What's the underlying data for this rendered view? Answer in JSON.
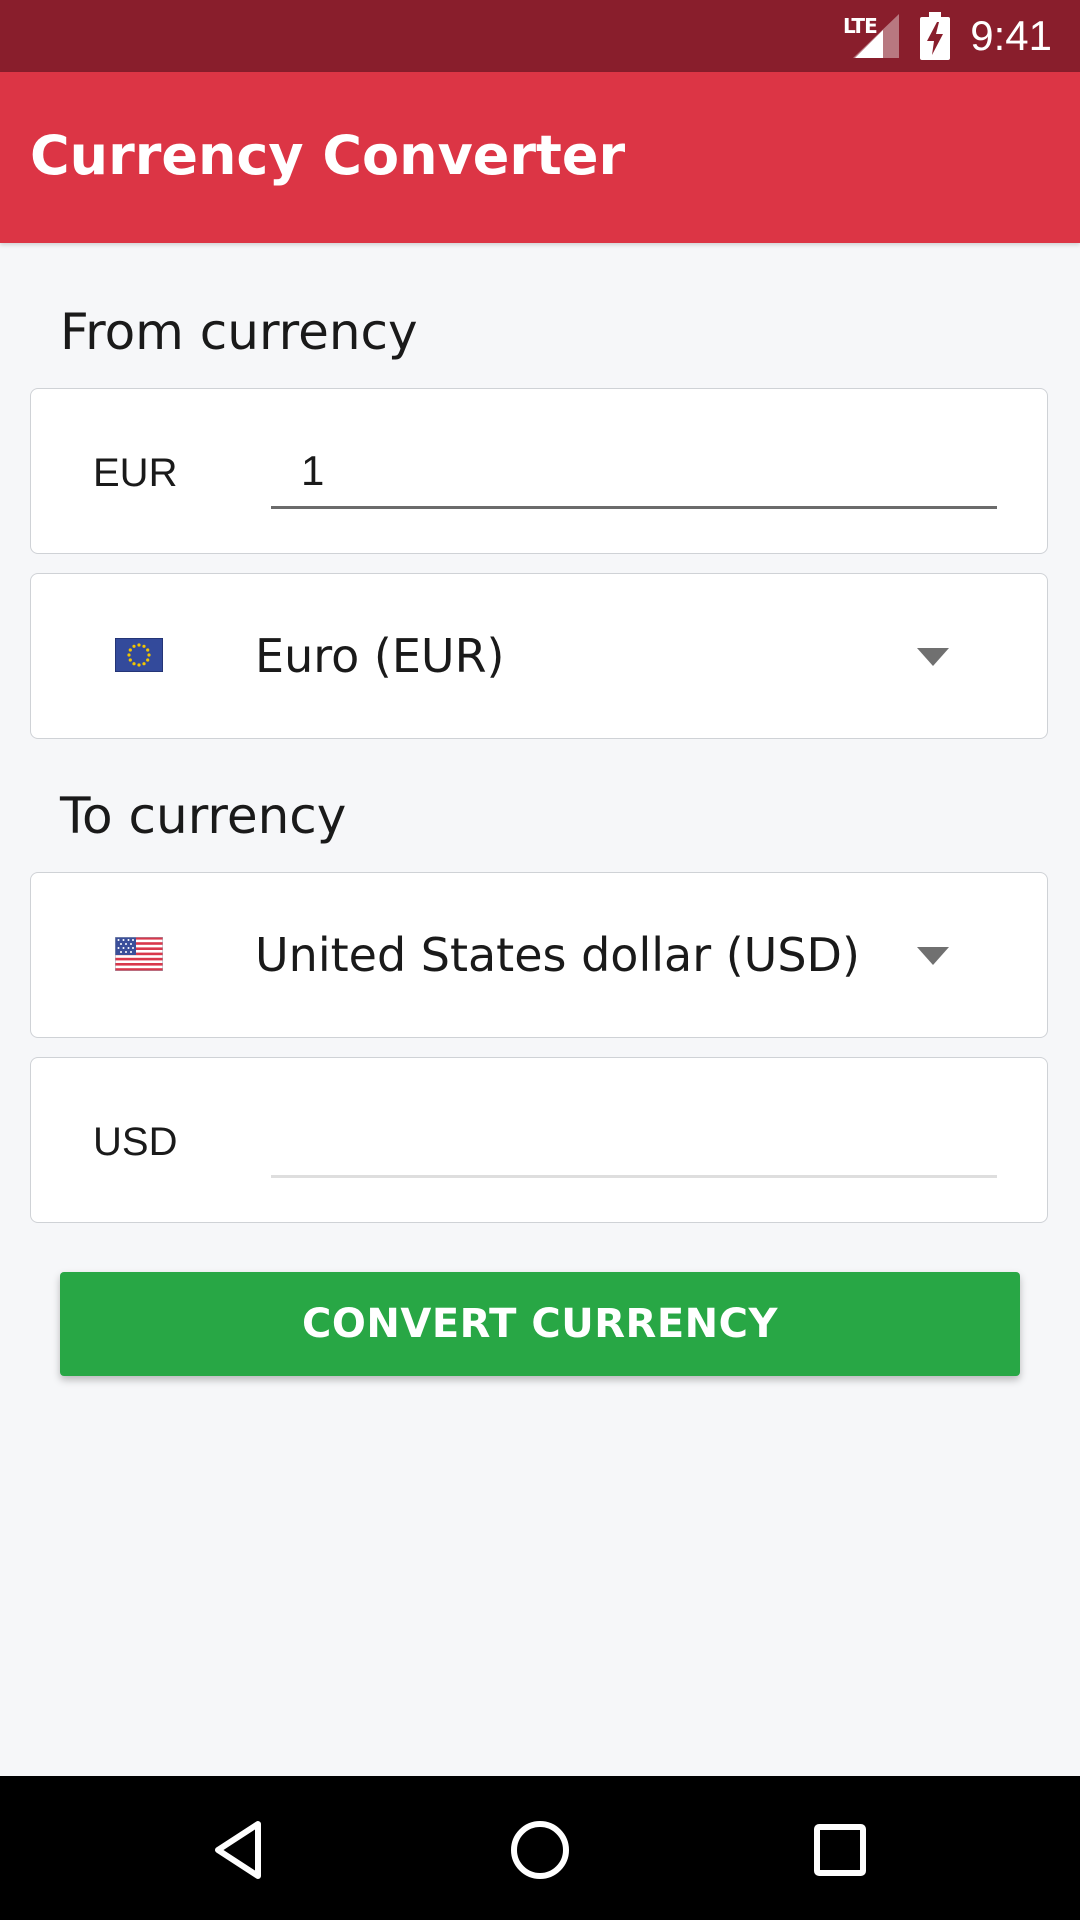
{
  "status_bar": {
    "network": "LTE",
    "time": "9:41",
    "signal_icon": "signal-icon",
    "battery_icon": "battery-charging-icon"
  },
  "app_bar": {
    "title": "Currency Converter"
  },
  "from": {
    "section_label": "From currency",
    "code": "EUR",
    "amount": "1",
    "selected_currency": "Euro (EUR)",
    "flag_icon": "eu-flag-icon"
  },
  "to": {
    "section_label": "To currency",
    "code": "USD",
    "amount": "",
    "selected_currency": "United States dollar (USD)",
    "flag_icon": "us-flag-icon"
  },
  "convert_button": {
    "label": "CONVERT CURRENCY"
  },
  "nav_bar": {
    "back_icon": "back-triangle-icon",
    "home_icon": "home-circle-icon",
    "recents_icon": "recents-square-icon"
  },
  "colors": {
    "status_bar": "#891e2c",
    "app_bar": "#dc3545",
    "background": "#f6f7f9",
    "convert_button": "#28a745",
    "nav_bar": "#000000"
  }
}
